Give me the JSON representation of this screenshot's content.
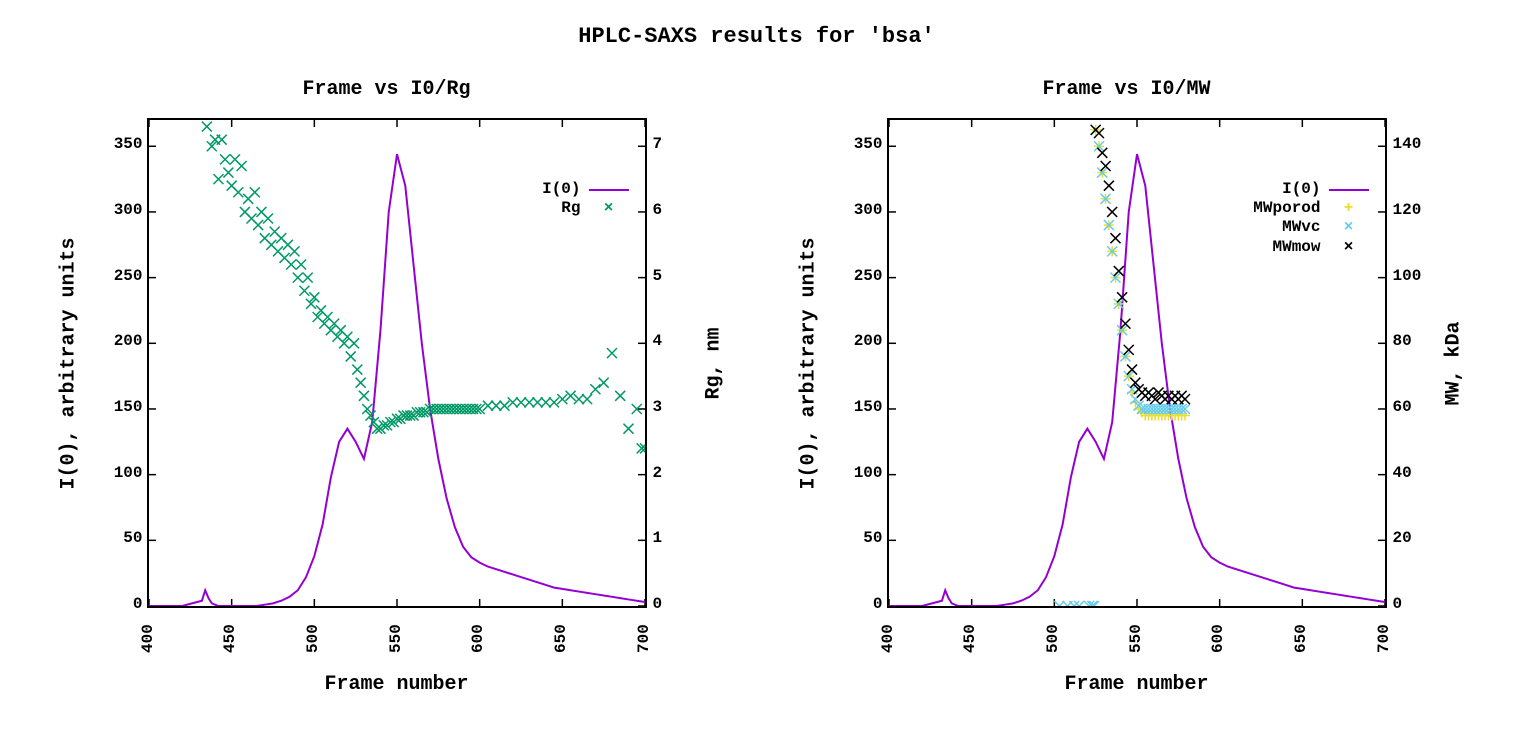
{
  "title": "HPLC-SAXS results for 'bsa'",
  "chart_data": [
    {
      "type": "line+scatter",
      "title": "Frame vs I0/Rg",
      "xlabel": "Frame number",
      "ylabel_left": "I(0), arbitrary units",
      "ylabel_right": "Rg, nm",
      "xticks": [
        400,
        450,
        500,
        550,
        600,
        650,
        700
      ],
      "yticks_left": [
        0,
        50,
        100,
        150,
        200,
        250,
        300,
        350
      ],
      "yticks_right": [
        0,
        1,
        2,
        3,
        4,
        5,
        6,
        7
      ],
      "xlim": [
        400,
        700
      ],
      "ylim_left": [
        0,
        370
      ],
      "ylim_right": [
        0,
        7.4
      ],
      "legend": [
        {
          "label": "I(0)",
          "type": "line",
          "color": "#9400d3"
        },
        {
          "label": "Rg",
          "type": "cross",
          "color": "#009966"
        }
      ],
      "series_left_line": {
        "name": "I(0)",
        "color": "#9400d3",
        "x": [
          400,
          420,
          432,
          434,
          436,
          438,
          442,
          446,
          450,
          455,
          460,
          465,
          470,
          475,
          480,
          485,
          490,
          495,
          500,
          505,
          510,
          515,
          520,
          525,
          530,
          535,
          540,
          545,
          550,
          555,
          560,
          565,
          570,
          575,
          580,
          585,
          590,
          595,
          600,
          605,
          610,
          615,
          620,
          625,
          630,
          635,
          640,
          645,
          650,
          655,
          660,
          665,
          670,
          675,
          680,
          685,
          690,
          695,
          700
        ],
        "y": [
          0,
          0,
          4,
          12,
          6,
          2,
          0,
          0,
          0,
          0,
          0,
          0,
          1,
          2,
          4,
          7,
          12,
          22,
          38,
          62,
          98,
          125,
          135,
          125,
          112,
          140,
          210,
          300,
          344,
          320,
          260,
          200,
          150,
          112,
          82,
          60,
          45,
          37,
          33,
          30,
          28,
          26,
          24,
          22,
          20,
          18,
          16,
          14,
          13,
          12,
          11,
          10,
          9,
          8,
          7,
          6,
          5,
          4,
          3
        ]
      },
      "series_right_scatter": {
        "name": "Rg",
        "color": "#009966",
        "x": [
          435,
          438,
          440,
          442,
          444,
          446,
          448,
          450,
          452,
          454,
          456,
          458,
          460,
          462,
          464,
          466,
          468,
          470,
          472,
          474,
          476,
          478,
          480,
          482,
          484,
          486,
          488,
          490,
          492,
          494,
          496,
          498,
          500,
          502,
          504,
          506,
          508,
          510,
          512,
          514,
          516,
          518,
          520,
          522,
          524,
          526,
          528,
          530,
          532,
          534,
          536,
          538,
          540,
          542,
          544,
          546,
          548,
          550,
          552,
          554,
          556,
          558,
          560,
          562,
          564,
          566,
          568,
          570,
          572,
          574,
          576,
          578,
          580,
          582,
          584,
          586,
          588,
          590,
          592,
          594,
          596,
          598,
          600,
          605,
          610,
          615,
          620,
          625,
          630,
          635,
          640,
          645,
          650,
          655,
          660,
          665,
          670,
          675,
          680,
          685,
          690,
          695,
          698,
          700
        ],
        "y": [
          7.3,
          7.0,
          7.1,
          6.5,
          7.1,
          6.8,
          6.6,
          6.4,
          6.8,
          6.3,
          6.7,
          6.0,
          6.2,
          5.9,
          6.3,
          5.8,
          6.0,
          5.6,
          5.9,
          5.5,
          5.7,
          5.4,
          5.6,
          5.3,
          5.5,
          5.2,
          5.4,
          5.0,
          5.2,
          4.8,
          5.0,
          4.6,
          4.7,
          4.4,
          4.5,
          4.3,
          4.4,
          4.2,
          4.3,
          4.1,
          4.2,
          4.0,
          4.1,
          3.8,
          4.0,
          3.6,
          3.4,
          3.2,
          3.0,
          2.9,
          2.8,
          2.7,
          2.7,
          2.75,
          2.75,
          2.8,
          2.8,
          2.85,
          2.85,
          2.9,
          2.9,
          2.9,
          2.9,
          2.95,
          2.95,
          2.95,
          2.95,
          3.0,
          3.0,
          3.0,
          3.0,
          3.0,
          3.0,
          3.0,
          3.0,
          3.0,
          3.0,
          3.0,
          3.0,
          3.0,
          3.0,
          3.0,
          3.0,
          3.05,
          3.05,
          3.05,
          3.1,
          3.1,
          3.1,
          3.1,
          3.1,
          3.1,
          3.15,
          3.2,
          3.15,
          3.15,
          3.3,
          3.4,
          3.85,
          3.2,
          2.7,
          3.0,
          2.4,
          2.4
        ]
      }
    },
    {
      "type": "line+scatter",
      "title": "Frame vs I0/MW",
      "xlabel": "Frame number",
      "ylabel_left": "I(0), arbitrary units",
      "ylabel_right": "MW, kDa",
      "xticks": [
        400,
        450,
        500,
        550,
        600,
        650,
        700
      ],
      "yticks_left": [
        0,
        50,
        100,
        150,
        200,
        250,
        300,
        350
      ],
      "yticks_right": [
        0,
        20,
        40,
        60,
        80,
        100,
        120,
        140
      ],
      "xlim": [
        400,
        700
      ],
      "ylim_left": [
        0,
        370
      ],
      "ylim_right": [
        0,
        148
      ],
      "legend": [
        {
          "label": "I(0)",
          "type": "line",
          "color": "#9400d3"
        },
        {
          "label": "MWporod",
          "type": "plus",
          "color": "#eedd22"
        },
        {
          "label": "MWvc",
          "type": "cross",
          "color": "#66ccee"
        },
        {
          "label": "MWmow",
          "type": "cross",
          "color": "#000000"
        }
      ],
      "series_left_line": {
        "name": "I(0)",
        "color": "#9400d3",
        "x": [
          400,
          420,
          432,
          434,
          436,
          438,
          442,
          446,
          450,
          455,
          460,
          465,
          470,
          475,
          480,
          485,
          490,
          495,
          500,
          505,
          510,
          515,
          520,
          525,
          530,
          535,
          540,
          545,
          550,
          555,
          560,
          565,
          570,
          575,
          580,
          585,
          590,
          595,
          600,
          605,
          610,
          615,
          620,
          625,
          630,
          635,
          640,
          645,
          650,
          655,
          660,
          665,
          670,
          675,
          680,
          685,
          690,
          695,
          700
        ],
        "y": [
          0,
          0,
          4,
          12,
          6,
          2,
          0,
          0,
          0,
          0,
          0,
          0,
          1,
          2,
          4,
          7,
          12,
          22,
          38,
          62,
          98,
          125,
          135,
          125,
          112,
          140,
          210,
          300,
          344,
          320,
          260,
          200,
          150,
          112,
          82,
          60,
          45,
          37,
          33,
          30,
          28,
          26,
          24,
          22,
          20,
          18,
          16,
          14,
          13,
          12,
          11,
          10,
          9,
          8,
          7,
          6,
          5,
          4,
          3
        ]
      },
      "series_right_scatter_multi": [
        {
          "name": "MWporod",
          "color": "#eedd22",
          "marker": "plus",
          "x": [
            525,
            527,
            529,
            531,
            533,
            535,
            537,
            539,
            541,
            543,
            545,
            547,
            549,
            551,
            553,
            555,
            557,
            559,
            561,
            563,
            565,
            567,
            569,
            571,
            573,
            575,
            577,
            579
          ],
          "y": [
            145,
            140,
            132,
            124,
            116,
            108,
            100,
            92,
            84,
            76,
            70,
            65,
            62,
            60,
            59,
            58,
            58,
            58,
            58,
            58,
            58,
            58,
            58,
            58,
            58,
            58,
            58,
            58
          ]
        },
        {
          "name": "MWvc",
          "color": "#66ccee",
          "marker": "cross",
          "x": [
            503,
            508,
            512,
            515,
            521,
            523,
            524,
            525,
            527,
            529,
            531,
            533,
            535,
            537,
            539,
            541,
            543,
            545,
            547,
            549,
            551,
            553,
            555,
            557,
            559,
            561,
            563,
            565,
            567,
            569,
            571,
            573,
            575,
            577,
            579
          ],
          "y": [
            0,
            0,
            0,
            0,
            0,
            0,
            0,
            145,
            140,
            132,
            124,
            116,
            108,
            100,
            92,
            84,
            76,
            70,
            66,
            63,
            61,
            60,
            60,
            60,
            60,
            60,
            60,
            60,
            60,
            60,
            60,
            60,
            60,
            60,
            60
          ]
        },
        {
          "name": "MWmow",
          "color": "#000000",
          "marker": "cross",
          "x": [
            525,
            527,
            529,
            531,
            533,
            535,
            537,
            539,
            541,
            543,
            545,
            547,
            549,
            551,
            553,
            555,
            557,
            559,
            561,
            563,
            565,
            567,
            569,
            571,
            573,
            575,
            577,
            579
          ],
          "y": [
            145,
            144,
            138,
            134,
            128,
            120,
            112,
            102,
            94,
            86,
            78,
            72,
            68,
            66,
            65,
            64,
            65,
            64,
            63,
            65,
            64,
            63,
            64,
            63,
            64,
            63,
            64,
            63
          ]
        }
      ]
    }
  ]
}
